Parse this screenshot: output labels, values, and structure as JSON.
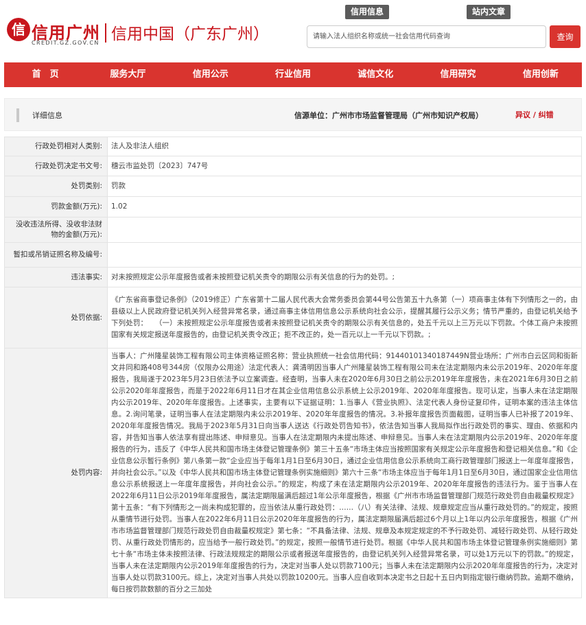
{
  "header": {
    "logo_emblem": "信",
    "logo_title": "信用广州",
    "logo_url": "CREDIT.GZ.GOV.CN",
    "site_name": "信用中国（广东广州）",
    "search_tabs": [
      "信用信息",
      "站内文章"
    ],
    "search_placeholder": "请输入法人组织名称或统一社会信用代码查询",
    "search_button": "查询"
  },
  "nav": {
    "items": [
      "首　页",
      "服务大厅",
      "信用公示",
      "行业信用",
      "诚信文化",
      "信用研究",
      "信用创新"
    ]
  },
  "detail": {
    "title": "详细信息",
    "source": "信源单位：广州市市场监督管理局（广州市知识产权局）",
    "correct_link": "异议 / 纠错"
  },
  "rows": [
    {
      "label": "行政处罚相对人类别:",
      "value": "法人及非法人组织"
    },
    {
      "label": "行政处罚决定书文号:",
      "value": "穗云市监处罚〔2023〕747号"
    },
    {
      "label": "处罚类别:",
      "value": "罚款"
    },
    {
      "label": "罚款金额(万元):",
      "value": "1.02"
    },
    {
      "label": "没收违法所得、没收非法财物的金额(万元):",
      "value": ""
    },
    {
      "label": "暂扣或吊销证照名称及编号:",
      "value": ""
    },
    {
      "label": "违法事实:",
      "value": "对未按照规定公示年度报告或者未按照登记机关责令的期限公示有关信息的行为的处罚。;"
    },
    {
      "label": "处罚依据:",
      "value": "《广东省商事登记条例》（2019修正）广东省第十二届人民代表大会常务委员会第44号公告第五十九条第（一）项商事主体有下列情形之一的，由县级以上人民政府登记机关列入经营异常名录，通过商事主体信用信息公示系统向社会公示，提醒其履行公示义务；情节严重的，由登记机关给予下列处罚：　　（一）未按照规定公示年度报告或者未按照登记机关责令的期限公示有关信息的，处五千元以上三万元以下罚款。个体工商户未按照国家有关规定报送年度报告的，由登记机关责令改正；拒不改正的，处一百元以上一千元以下罚款。;"
    },
    {
      "label": "处罚内容:",
      "value": "当事人：广州隆星装饰工程有限公司主体资格证照名称：营业执照统一社会信用代码：91440101340187449N营业场所：广州市白云区同和街新文井同和路408号344房（仅限办公用途）法定代表人：龚清明因当事人广州隆星装饰工程有限公司未在法定期限内未公示2019年、2020年年度报告，我局遂于2023年5月23日依法予以立案调查。经查明，当事人未在2020年6月30日之前公示2019年年度报告，未在2021年6月30日之前公示2020年年度报告，而是于2022年6月11日才在其企业信用信息公示系统上公示2019年、2020年年度报告。现可认定，当事人未在法定期限内公示2019年、2020年年度报告。上述事实，主要有以下证据证明：1.当事人《营业执照》、法定代表人身份证复印件，证明本案的违法主体信息。2.询问笔录，证明当事人在法定期限内未公示2019年、2020年年度报告的情况。3.补报年度报告页面截图，证明当事人已补报了2019年、2020年年度报告情况。我局于2023年5月31日向当事人送达《行政处罚告知书》，依法告知当事人我局拟作出行政处罚的事实、理由、依据和内容，并告知当事人依法享有提出陈述、申辩意见。当事人在法定期限内未提出陈述、申辩意见。当事人未在法定期限内公示2019年、2020年年度报告的行为，违反了《中华人民共和国市场主体登记管理条例》第三十五条“市场主体应当按照国家有关规定公示年度报告和登记相关信息。”和《企业信息公示暂行条例》第八条第一款“企业应当于每年1月1日至6月30日，通过企业信用信息公示系统向工商行政管理部门报送上一年度年度报告，并向社会公示。”以及《中华人民共和国市场主体登记管理条例实施细则》第六十三条“市场主体应当于每年1月1日至6月30日，通过国家企业信用信息公示系统报送上一年度年度报告，并向社会公示。”的规定，构成了未在法定期限内公示2019年、2020年年度报告的违法行为。鉴于当事人在2022年6月11日公示2019年年度报告，属法定期限届满后超过1年公示年度报告，根据《广州市市场监督管理部门规范行政处罚自由裁量权规定》第十五条：“有下列情形之一尚未构成犯罪的，应当依法从重行政处罚：……（八）有关法律、法规、规章规定应当从重行政处罚的。”的规定，按照从重情节进行处罚。当事人在2022年6月11日公示2020年年度报告的行为，属法定期限届满后超过6个月以上1年以内公示年度报告，根据《广州市市场监督管理部门规范行政处罚自由裁量权规定》第七条：“不具备法律、法规、规章及本规定规定的不予行政处罚、减轻行政处罚、从轻行政处罚、从重行政处罚情形的，应当给予一般行政处罚。”的规定，按照一般情节进行处罚。根据《中华人民共和国市场主体登记管理条例实施细则》第七十条“市场主体未按照法律、行政法规规定的期限公示或者报送年度报告的，由登记机关列入经营异常名录，可以处1万元以下的罚款。”的规定，当事人未在法定期限内公示2019年年度报告的行为，决定对当事人处以罚款7100元；当事人未在法定期限内公示2020年年度报告的行为，决定对当事人处以罚款3100元。综上，决定对当事人共处以罚款10200元。当事人应自收到本决定书之日起十五日内到指定银行缴纳罚款。逾期不缴纳，每日按罚款数额的百分之三加处"
    }
  ]
}
